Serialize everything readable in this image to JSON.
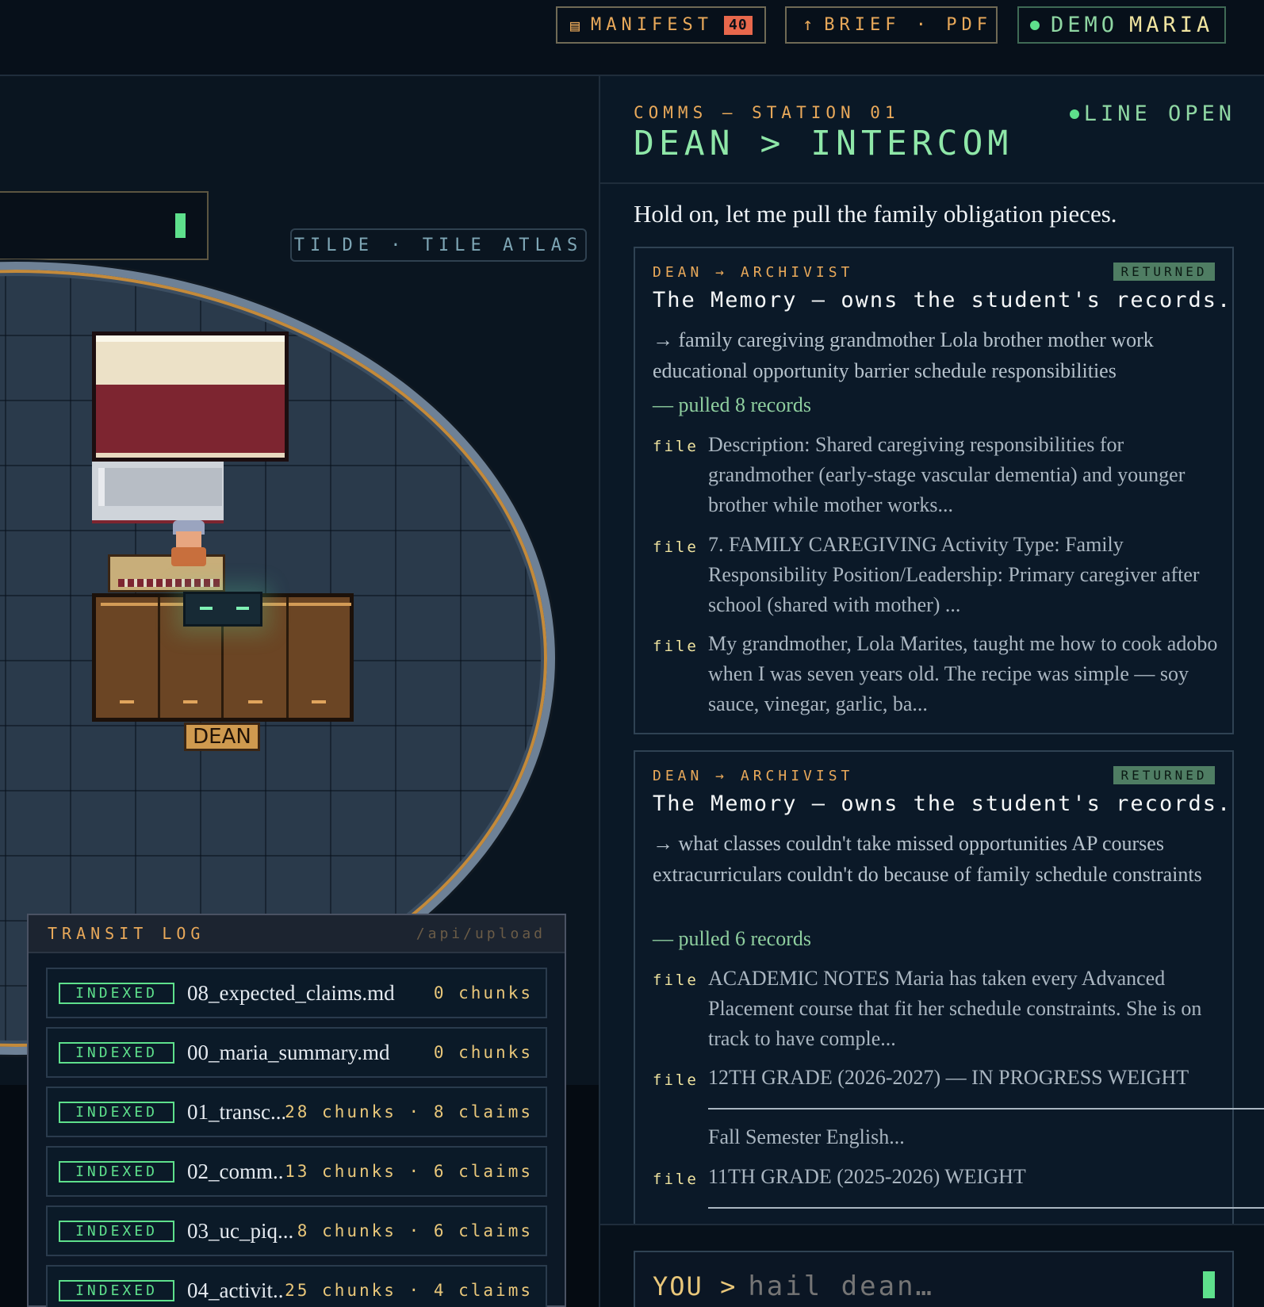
{
  "topbar": {
    "manifest": {
      "icon": "document-icon",
      "label": "MANIFEST",
      "count": "40"
    },
    "brief": {
      "icon": "upload-arrow-icon",
      "label": "BRIEF · PDF"
    },
    "demo": {
      "label": "DEMO",
      "user": "MARIA",
      "status_color": "#5ee08c"
    }
  },
  "map": {
    "atlas_label": "TILDE · TILE ATLAS",
    "npc_tag": "DEAN"
  },
  "transit_log": {
    "title": "TRANSIT LOG",
    "path": "/api/upload",
    "rows": [
      {
        "status": "INDEXED",
        "file": "08_expected_claims.md",
        "meta": "0 chunks"
      },
      {
        "status": "INDEXED",
        "file": "00_maria_summary.md",
        "meta": "0 chunks"
      },
      {
        "status": "INDEXED",
        "file": "01_transc...",
        "meta": "28 chunks · 8 claims"
      },
      {
        "status": "INDEXED",
        "file": "02_comm...",
        "meta": "13 chunks · 6 claims"
      },
      {
        "status": "INDEXED",
        "file": "03_uc_piq...",
        "meta": "8 chunks · 6 claims"
      },
      {
        "status": "INDEXED",
        "file": "04_activit...",
        "meta": "25 chunks · 4 claims"
      }
    ]
  },
  "comms": {
    "station": "COMMS — STATION 01",
    "title": "DEAN > INTERCOM",
    "line_status": "LINE OPEN",
    "message": "Hold on, let me pull the family obligation pieces.",
    "cards": [
      {
        "route": "DEAN → ARCHIVIST",
        "status": "RETURNED",
        "title": "The Memory — owns the student's records.",
        "query": "→ family caregiving grandmother Lola brother mother work educational opportunity barrier schedule responsibilities",
        "pulled": "— pulled 8 records",
        "records": [
          {
            "label": "file",
            "text": "Description: Shared caregiving responsibilities for grandmother (early-stage vascular dementia) and younger brother while mother works..."
          },
          {
            "label": "file",
            "text": "7. FAMILY CAREGIVING Activity Type: Family Responsibility Position/Leadership: Primary caregiver after school (shared with mother) ..."
          },
          {
            "label": "file",
            "text": "My grandmother, Lola Marites, taught me how to cook adobo when I was seven years old. The recipe was simple — soy sauce, vinegar, garlic, ba..."
          }
        ]
      },
      {
        "route": "DEAN → ARCHIVIST",
        "status": "RETURNED",
        "title": "The Memory — owns the student's records.",
        "query": "→ what classes couldn't take missed opportunities AP courses extracurriculars couldn't do because of family schedule constraints",
        "pulled": "— pulled 6 records",
        "records": [
          {
            "label": "file",
            "text": "ACADEMIC NOTES Maria has taken every Advanced Placement course that fit her schedule constraints. She is on track to have comple..."
          },
          {
            "label": "file",
            "text": "12TH GRADE (2026-2027) — IN PROGRESS WEIGHT",
            "text2": "Fall Semester English..."
          },
          {
            "label": "file",
            "text": "11TH GRADE (2025-2026) WEIGHT"
          }
        ]
      }
    ],
    "input": {
      "prefix": "YOU >",
      "placeholder": "hail dean…"
    }
  }
}
